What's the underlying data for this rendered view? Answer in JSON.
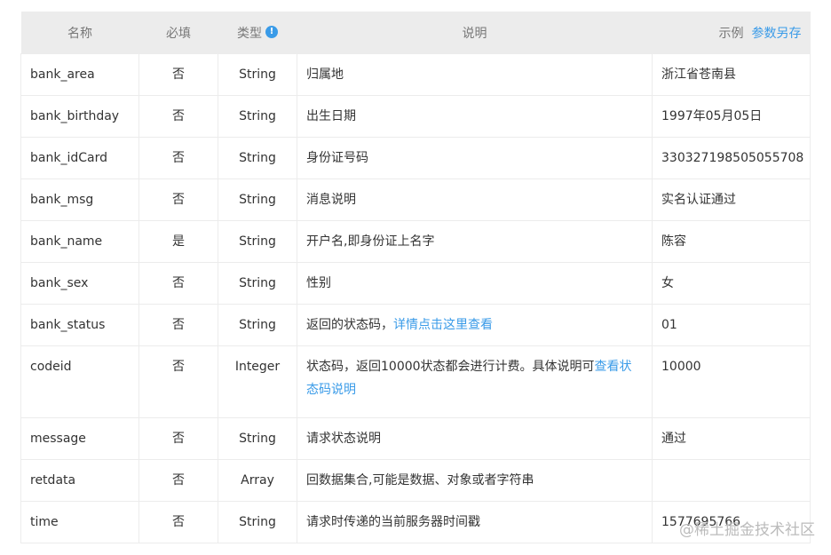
{
  "header": {
    "name": "名称",
    "required": "必填",
    "type": "类型",
    "info_icon": "info-icon",
    "description": "说明",
    "example": "示例",
    "save_link": "参数另存"
  },
  "rows": [
    {
      "name": "bank_area",
      "required": "否",
      "type": "String",
      "desc": "归属地",
      "example": "浙江省苍南县"
    },
    {
      "name": "bank_birthday",
      "required": "否",
      "type": "String",
      "desc": "出生日期",
      "example": "1997年05月05日"
    },
    {
      "name": "bank_idCard",
      "required": "否",
      "type": "String",
      "desc": "身份证号码",
      "example": "330327198505055708"
    },
    {
      "name": "bank_msg",
      "required": "否",
      "type": "String",
      "desc": "消息说明",
      "example": "实名认证通过"
    },
    {
      "name": "bank_name",
      "required": "是",
      "type": "String",
      "desc": "开户名,即身份证上名字",
      "example": "陈容"
    },
    {
      "name": "bank_sex",
      "required": "否",
      "type": "String",
      "desc": "性别",
      "example": "女"
    },
    {
      "name": "bank_status",
      "required": "否",
      "type": "String",
      "desc": "返回的状态码，",
      "desc_link": "详情点击这里查看",
      "example": "01"
    },
    {
      "name": "codeid",
      "required": "否",
      "type": "Integer",
      "desc": "状态码，返回10000状态都会进行计费。具体说明可",
      "desc_link": "查看状态码说明",
      "example": "10000"
    },
    {
      "name": "message",
      "required": "否",
      "type": "String",
      "desc": "请求状态说明",
      "example": "通过"
    },
    {
      "name": "retdata",
      "required": "否",
      "type": "Array",
      "desc": "回数据集合,可能是数据、对象或者字符串",
      "example": ""
    },
    {
      "name": "time",
      "required": "否",
      "type": "String",
      "desc": "请求时传递的当前服务器时间戳",
      "example": "1577695766"
    }
  ],
  "watermark": "@稀土掘金技术社区",
  "colors": {
    "header_bg": "#ececec",
    "link": "#3a9be8",
    "border": "#ececec"
  }
}
